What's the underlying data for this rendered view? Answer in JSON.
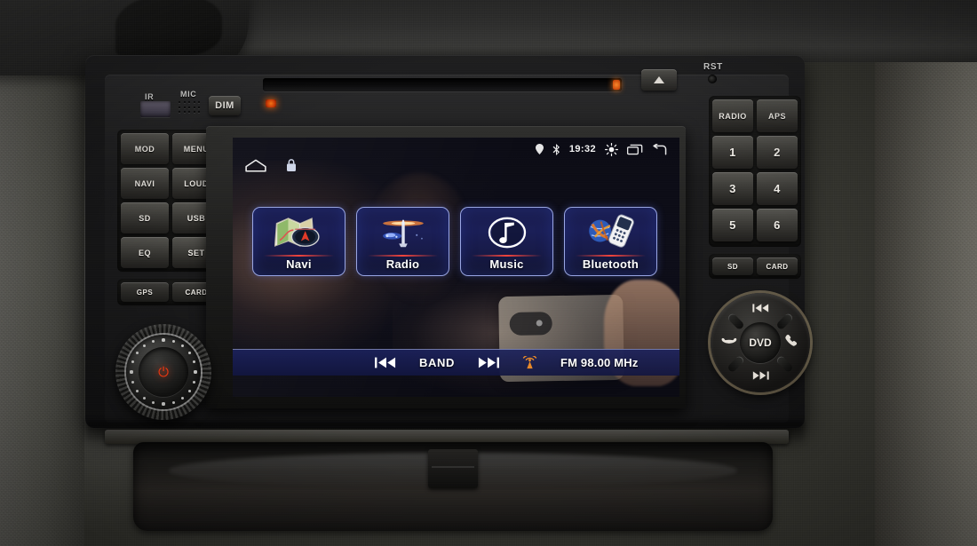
{
  "device": {
    "faceplate": {
      "ir_label": "IR",
      "mic_label": "MIC",
      "dim_label": "DIM",
      "rst_label": "RST",
      "eject_icon": "eject-triangle-icon"
    },
    "left_buttons": [
      {
        "label": "MOD",
        "name": "mod-button"
      },
      {
        "label": "MENU",
        "name": "menu-button"
      },
      {
        "label": "NAVI",
        "name": "navi-button"
      },
      {
        "label": "LOUD",
        "name": "loud-button"
      },
      {
        "label": "SD",
        "name": "sd-button"
      },
      {
        "label": "USB",
        "name": "usb-button"
      },
      {
        "label": "EQ",
        "name": "eq-button"
      },
      {
        "label": "SET",
        "name": "set-button"
      }
    ],
    "left_slots": [
      {
        "label": "GPS",
        "name": "gps-slot"
      },
      {
        "label": "CARD",
        "name": "card-slot-left"
      }
    ],
    "right_buttons": [
      {
        "label": "RADIO",
        "name": "radio-button"
      },
      {
        "label": "APS",
        "name": "aps-button"
      },
      {
        "label": "1",
        "name": "preset-1-button"
      },
      {
        "label": "2",
        "name": "preset-2-button"
      },
      {
        "label": "3",
        "name": "preset-3-button"
      },
      {
        "label": "4",
        "name": "preset-4-button"
      },
      {
        "label": "5",
        "name": "preset-5-button"
      },
      {
        "label": "6",
        "name": "preset-6-button"
      }
    ],
    "right_slots": [
      {
        "label": "SD",
        "name": "sd-slot-right"
      },
      {
        "label": "CARD",
        "name": "card-slot-right"
      }
    ],
    "volume_knob": {
      "name": "volume-power-knob",
      "icon": "power-icon"
    },
    "dvd_knob": {
      "center_label": "DVD",
      "top_icon": "previous-track-icon",
      "bottom_icon": "next-track-icon",
      "left_icon": "hang-up-phone-icon",
      "right_icon": "answer-call-icon"
    }
  },
  "screen": {
    "statusbar": {
      "gps_icon": "location-pin-icon",
      "bluetooth_icon": "bluetooth-icon",
      "time": "19:32",
      "brightness_icon": "brightness-icon",
      "recents_icon": "recent-apps-icon",
      "back_icon": "back-arrow-icon"
    },
    "navbar": {
      "home_icon": "home-icon",
      "lock_icon": "lock-icon"
    },
    "tiles": [
      {
        "label": "Navi",
        "icon": "map-navigation-icon"
      },
      {
        "label": "Radio",
        "icon": "radio-tower-icon"
      },
      {
        "label": "Music",
        "icon": "music-note-icon"
      },
      {
        "label": "Bluetooth",
        "icon": "bluetooth-phone-icon"
      }
    ],
    "mediabar": {
      "prev_icon": "previous-track-icon",
      "band_label": "BAND",
      "next_icon": "next-track-icon",
      "antenna_icon": "antenna-signal-icon",
      "frequency": "FM 98.00 MHz"
    },
    "colors": {
      "tile_border": "#b0beff",
      "tile_fill": "#1b1f57",
      "accent_red": "#ff463c",
      "antenna_orange": "#e8892a",
      "text": "#ffffff"
    }
  }
}
